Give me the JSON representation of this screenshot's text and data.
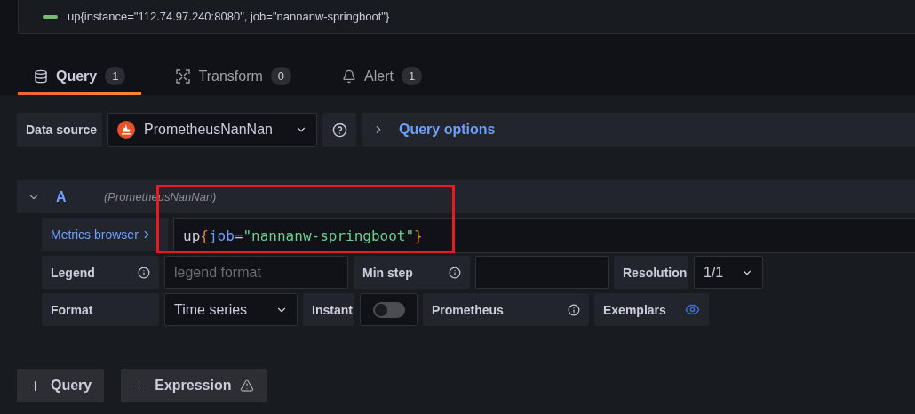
{
  "legend_panel": {
    "series": [
      {
        "label": "up{instance=\"112.74.97.240:8080\", job=\"nannanw-springboot\"}",
        "color": "#73bf69"
      }
    ]
  },
  "tabs": [
    {
      "label": "Query",
      "count": "1",
      "selected": true
    },
    {
      "label": "Transform",
      "count": "0",
      "selected": false
    },
    {
      "label": "Alert",
      "count": "1",
      "selected": false
    }
  ],
  "data_source": {
    "label": "Data source",
    "value": "PrometheusNanNan",
    "query_options": "Query options"
  },
  "query": {
    "ref": "A",
    "source": "(PrometheusNanNan)",
    "expanded": true,
    "metrics_browser": "Metrics browser",
    "code": [
      {
        "text": "up",
        "kind": "metric"
      },
      {
        "text": "{",
        "kind": "brace"
      },
      {
        "text": "job",
        "kind": "label"
      },
      {
        "text": "=",
        "kind": "operator"
      },
      {
        "text": "\"nannanw-springboot\"",
        "kind": "string"
      },
      {
        "text": "}",
        "kind": "brace"
      }
    ],
    "legend": {
      "label": "Legend",
      "placeholder": "legend format"
    },
    "min_step": {
      "label": "Min step"
    },
    "resolution": {
      "label": "Resolution",
      "value": "1/1"
    },
    "format": {
      "label": "Format",
      "value": "Time series"
    },
    "instant": {
      "label": "Instant",
      "on": false
    },
    "type": {
      "label": "Prometheus"
    },
    "exemplars": {
      "label": "Exemplars",
      "on": true
    }
  },
  "buttons": [
    {
      "label": "Query",
      "warning": false
    },
    {
      "label": "Expression",
      "warning": true
    }
  ]
}
